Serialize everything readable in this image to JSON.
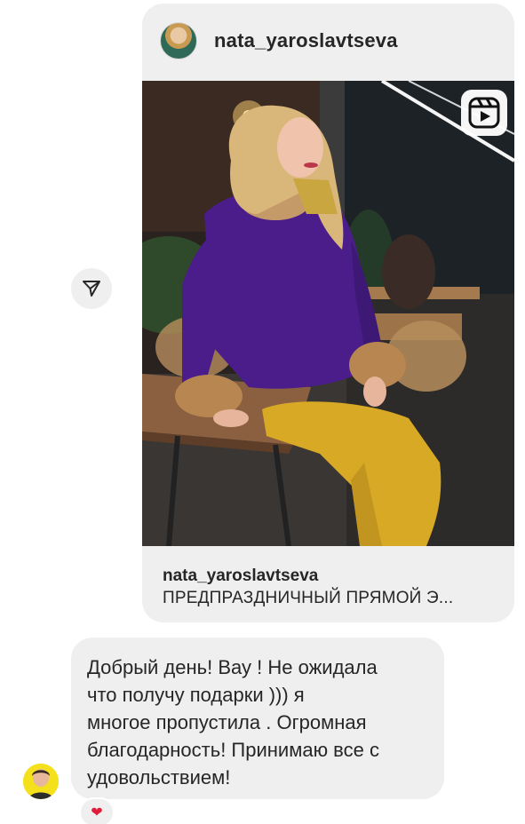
{
  "shared_post": {
    "username": "nata_yaroslavtseva",
    "caption_username": "nata_yaroslavtseva",
    "caption_text": "ПРЕДПРАЗДНИЧНЫЙ ПРЯМОЙ Э...",
    "media_type_icon": "reels-play-icon"
  },
  "share_action_icon": "paper-plane-icon",
  "message": {
    "text": "Добрый день! Вау ! Не ожидала\nчто получу подарки ))) я\nмногое пропустила . Огромная\nблагодарность! Принимаю все с\nудовольствием!",
    "reaction": "❤",
    "reaction_color": "#e01e3c"
  },
  "colors": {
    "bubble": "#efefef",
    "text": "#262626",
    "sender_avatar_bg": "#f4e11b"
  }
}
